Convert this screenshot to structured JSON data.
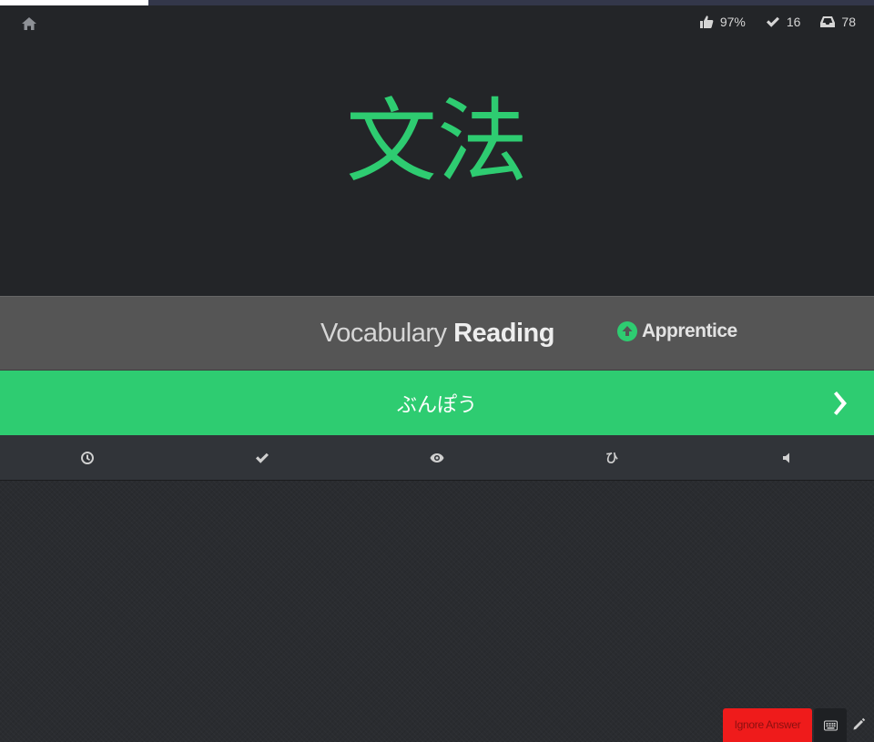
{
  "progress": {
    "fraction": 0.17
  },
  "header": {
    "home_icon": "home-icon",
    "stats": {
      "percent_correct": "97%",
      "completed_count": "16",
      "remaining_count": "78"
    }
  },
  "item": {
    "characters": "文法",
    "character_color": "#2ecc71"
  },
  "question": {
    "type": "Vocabulary",
    "category": "Reading",
    "srs_level": "Apprentice"
  },
  "answer": {
    "value": "ぶんぽう",
    "submit_icon": "chevron-right-icon",
    "bar_color": "#2ecc71"
  },
  "toolbar": {
    "items": [
      {
        "icon": "clock-icon"
      },
      {
        "icon": "check-icon"
      },
      {
        "icon": "eye-icon"
      },
      {
        "icon": "hiragana-hi-icon",
        "glyph": "ひ"
      },
      {
        "icon": "speaker-icon"
      }
    ]
  },
  "footer": {
    "ignore_label": "Ignore Answer",
    "ignore_color": "#ef1b1b"
  }
}
